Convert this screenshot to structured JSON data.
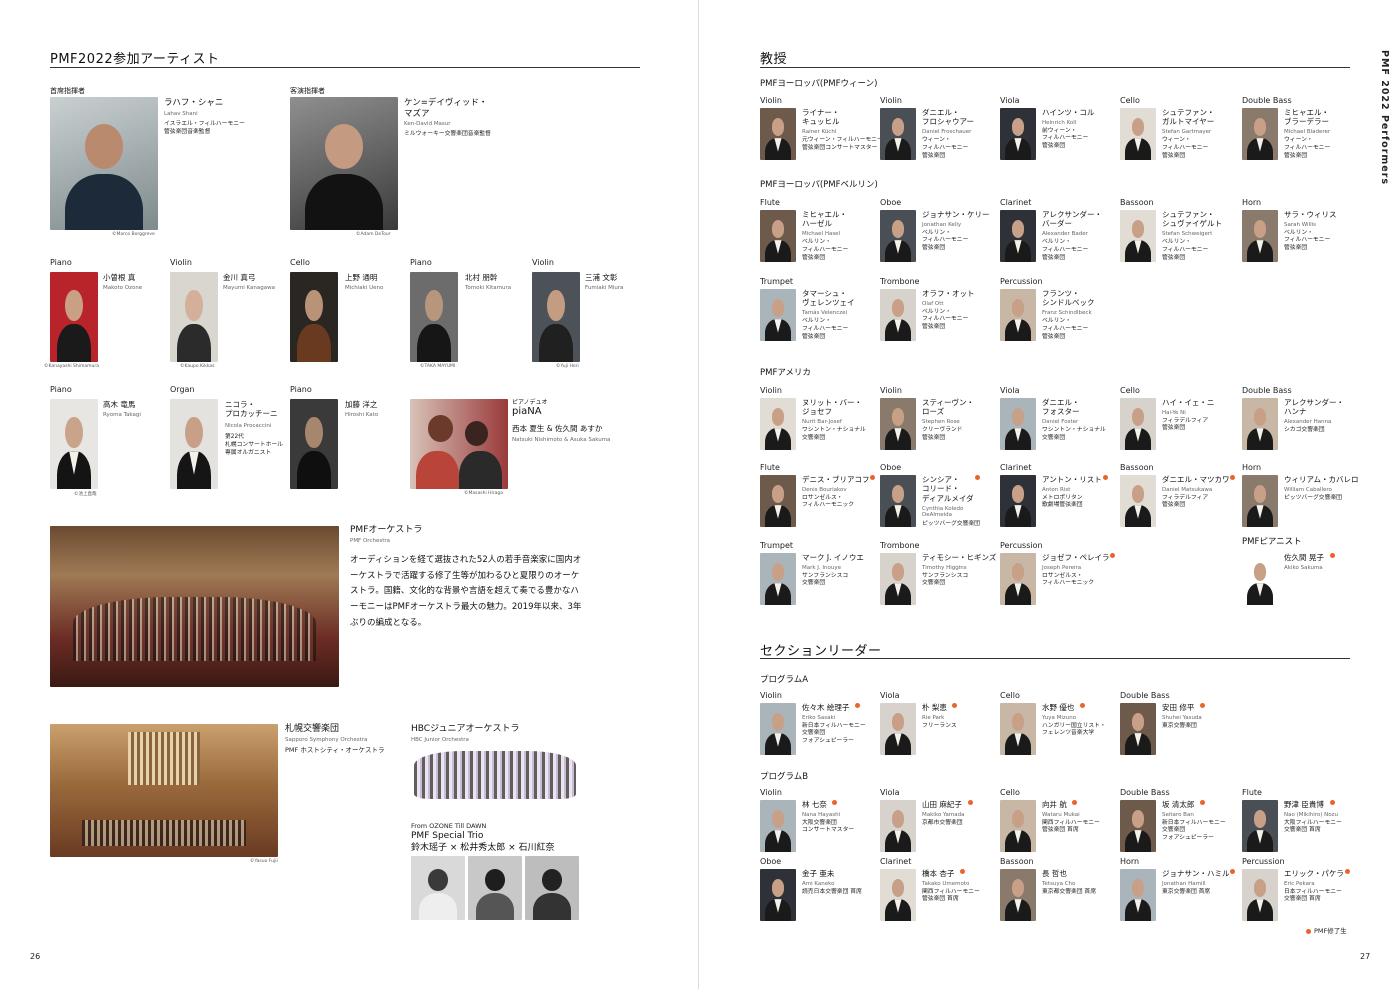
{
  "left": {
    "title": "PMF2022参加アーティスト",
    "conductors": [
      {
        "role": "首席指揮者",
        "name": "ラハフ・シャニ",
        "roman": "Lahav Shani",
        "org": "イスラエル・フィルハーモニー\n管弦楽団音楽監督",
        "credit": "©Marco Borggreve"
      },
      {
        "role": "客演指揮者",
        "name": "ケン=デイヴィッド・\nマズア",
        "roman": "Ken-David Masur",
        "org": "ミルウォーキー交響楽団音楽監督",
        "credit": "©Adam DeTour"
      }
    ],
    "soloists_row1": [
      {
        "inst": "Piano",
        "name": "小曽根 真",
        "roman": "Makoto Ozone",
        "credit": "©Kanayashi Shimamura"
      },
      {
        "inst": "Violin",
        "name": "金川 真弓",
        "roman": "Mayumi Kanagawa",
        "credit": "©Kaupo Kikkas"
      },
      {
        "inst": "Cello",
        "name": "上野 通明",
        "roman": "Michiaki Ueno",
        "credit": ""
      },
      {
        "inst": "Piano",
        "name": "北村 朋幹",
        "roman": "Tomoki Kitamura",
        "credit": "©TAKA MAYUMI"
      },
      {
        "inst": "Violin",
        "name": "三浦 文彰",
        "roman": "Fumiaki Miura",
        "credit": "©Yuji Hori"
      }
    ],
    "soloists_row2": [
      {
        "inst": "Piano",
        "name": "高木 竜馬",
        "roman": "Ryoma Takagi",
        "org": "",
        "credit": "©池上直哉"
      },
      {
        "inst": "Organ",
        "name": "ニコラ・\nプロカッチーニ",
        "roman": "Nicola Procaccini",
        "org": "第22代\n札幌コンサートホール\n専属オルガニスト",
        "credit": ""
      },
      {
        "inst": "Piano",
        "name": "加藤 洋之",
        "roman": "Hiroshi Kato",
        "org": "",
        "credit": ""
      }
    ],
    "piana": {
      "inst": "ピアノデュオ",
      "name": "piaNA",
      "members": "西本 夏生 & 佐久間 あすか",
      "roman": "Natsuki Nishimoto & Asuka Sakuma",
      "credit": "©Masashi Hiraga"
    },
    "orchestra": {
      "name": "PMFオーケストラ",
      "roman": "PMF Orchestra",
      "desc": "オーディションを経て選抜された52人の若手音楽家に国内オーケストラで活躍する修了生等が加わるひと夏限りのオーケストラ。国籍、文化的な背景や言語を超えて奏でる豊かなハーモニーはPMFオーケストラ最大の魅力。2019年以来、3年ぶりの編成となる。"
    },
    "sapporo": {
      "name": "札幌交響楽団",
      "roman": "Sapporo Symphony Orchestra",
      "note": "PMF ホストシティ・オーケストラ",
      "credit": "©Yasuo Fujii"
    },
    "hbc": {
      "name": "HBCジュニアオーケストラ",
      "roman": "HBC Junior Orchestra"
    },
    "trio": {
      "from": "From OZONE Till DAWN",
      "name": "PMF Special Trio",
      "members": "鈴木瑶子 × 松井秀太郎 × 石川紅奈"
    },
    "page_num": "26"
  },
  "right": {
    "title": "教授",
    "vertical_title": "PMF 2022  Performers",
    "groups": [
      {
        "label": "PMFヨーロッパ(PMFウィーン)"
      },
      {
        "label": "PMFヨーロッパ(PMFベルリン)"
      },
      {
        "label": "PMFアメリカ"
      },
      {
        "label": "PMFピアニスト"
      }
    ],
    "vienna": [
      {
        "inst": "Violin",
        "name": "ライナー・\nキュッヒル",
        "roman": "Rainer Küchl",
        "org": "元ウィーン・フィルハーモニー\n管弦楽団コンサートマスター",
        "dot": false
      },
      {
        "inst": "Violin",
        "name": "ダニエル・\nフロシャウアー",
        "roman": "Daniel Froschauer",
        "org": "ウィーン・\nフィルハーモニー\n管弦楽団",
        "dot": false
      },
      {
        "inst": "Viola",
        "name": "ハインツ・コル",
        "roman": "Heinrich Koll",
        "org": "前ウィーン・\nフィルハーモニー\n管弦楽団",
        "dot": false
      },
      {
        "inst": "Cello",
        "name": "シュテファン・\nガルトマイヤー",
        "roman": "Stefan Gartmayer",
        "org": "ウィーン・\nフィルハーモニー\n管弦楽団",
        "dot": false
      },
      {
        "inst": "Double Bass",
        "name": "ミヒャエル・\nブラーデラー",
        "roman": "Michael Bladerer",
        "org": "ウィーン・\nフィルハーモニー\n管弦楽団",
        "dot": false
      }
    ],
    "berlin": [
      {
        "inst": "Flute",
        "name": "ミヒャエル・\nハーゼル",
        "roman": "Michael Hasel",
        "org": "ベルリン・\nフィルハーモニー\n管弦楽団",
        "dot": false
      },
      {
        "inst": "Oboe",
        "name": "ジョナサン・ケリー",
        "roman": "Jonathan Kelly",
        "org": "ベルリン・\nフィルハーモニー\n管弦楽団",
        "dot": false
      },
      {
        "inst": "Clarinet",
        "name": "アレクサンダー・\nバーダー",
        "roman": "Alexander Bader",
        "org": "ベルリン・\nフィルハーモニー\n管弦楽団",
        "dot": false
      },
      {
        "inst": "Bassoon",
        "name": "シュテファン・\nシュヴァイゲルト",
        "roman": "Stefan Schweigert",
        "org": "ベルリン・\nフィルハーモニー\n管弦楽団",
        "dot": false
      },
      {
        "inst": "Horn",
        "name": "サラ・ウィリス",
        "roman": "Sarah Willis",
        "org": "ベルリン・\nフィルハーモニー\n管弦楽団",
        "dot": false
      },
      {
        "inst": "Trumpet",
        "name": "タマーシュ・\nヴェレンツェイ",
        "roman": "Tamás Velenczei",
        "org": "ベルリン・\nフィルハーモニー\n管弦楽団",
        "dot": false
      },
      {
        "inst": "Trombone",
        "name": "オラフ・オット",
        "roman": "Olaf Ott",
        "org": "ベルリン・\nフィルハーモニー\n管弦楽団",
        "dot": false
      },
      {
        "inst": "Percussion",
        "name": "フランツ・\nシンドルベック",
        "roman": "Franz Schindlbeck",
        "org": "ベルリン・\nフィルハーモニー\n管弦楽団",
        "dot": false
      }
    ],
    "america": [
      {
        "inst": "Violin",
        "name": "ヌリット・バー・\nジョセフ",
        "roman": "Nurit Bar-Josef",
        "org": "ワシントン・ナショナル\n交響楽団",
        "dot": false
      },
      {
        "inst": "Violin",
        "name": "スティーヴン・\nローズ",
        "roman": "Stephen Rose",
        "org": "クリーヴランド\n管弦楽団",
        "dot": false
      },
      {
        "inst": "Viola",
        "name": "ダニエル・\nフォスター",
        "roman": "Daniel Foster",
        "org": "ワシントン・ナショナル\n交響楽団",
        "dot": false
      },
      {
        "inst": "Cello",
        "name": "ハイ・イェ・ニ",
        "roman": "Hai-Ye Ni",
        "org": "フィラデルフィア\n管弦楽団",
        "dot": false
      },
      {
        "inst": "Double Bass",
        "name": "アレクサンダー・\nハンナ",
        "roman": "Alexander Hanna",
        "org": "シカゴ交響楽団",
        "dot": false
      },
      {
        "inst": "Flute",
        "name": "デニス・ブリアコフ",
        "roman": "Denis Bouriakov",
        "org": "ロサンゼルス・\nフィルハーモニック",
        "dot": true
      },
      {
        "inst": "Oboe",
        "name": "シンシア・\nコリード・\nディアルメイダ",
        "roman": "Cynthia Koledo\nDeAlmeida",
        "org": "ピッツバーグ交響楽団",
        "dot": true
      },
      {
        "inst": "Clarinet",
        "name": "アントン・リスト",
        "roman": "Anton Rist",
        "org": "メトロポリタン\n歌劇場管弦楽団",
        "dot": true
      },
      {
        "inst": "Bassoon",
        "name": "ダニエル・マツカワ",
        "roman": "Daniel Matsukawa",
        "org": "フィラデルフィア\n管弦楽団",
        "dot": true
      },
      {
        "inst": "Horn",
        "name": "ウィリアム・カバレロ",
        "roman": "William Caballero",
        "org": "ピッツバーグ交響楽団",
        "dot": false
      },
      {
        "inst": "Trumpet",
        "name": "マーク J. イノウエ",
        "roman": "Mark J. Inouye",
        "org": "サンフランシスコ\n交響楽団",
        "dot": false
      },
      {
        "inst": "Trombone",
        "name": "ティモシー・ヒギンズ",
        "roman": "Timothy Higgins",
        "org": "サンフランシスコ\n交響楽団",
        "dot": false
      },
      {
        "inst": "Percussion",
        "name": "ジョゼフ・ペレイラ",
        "roman": "Joseph Pereira",
        "org": "ロサンゼルス・\nフィルハーモニック",
        "dot": true
      }
    ],
    "pianist": {
      "name": "佐久間 晃子",
      "roman": "Akiko Sakuma",
      "dot": true
    },
    "section_title": "セクションリーダー",
    "progA_label": "プログラムA",
    "progA": [
      {
        "inst": "Violin",
        "name": "佐々木 絵理子",
        "roman": "Eriko Sasaki",
        "org": "新日本フィルハーモニー\n交響楽団\nフォアシュピーラー",
        "dot": true
      },
      {
        "inst": "Viola",
        "name": "朴 梨恵",
        "roman": "Rie Park",
        "org": "フリーランス",
        "dot": true
      },
      {
        "inst": "Cello",
        "name": "水野 優也",
        "roman": "Yuya Mizuno",
        "org": "ハンガリー国立リスト・\nフェレンツ音楽大学",
        "dot": true
      },
      {
        "inst": "Double Bass",
        "name": "安田 修平",
        "roman": "Shuhei Yasuda",
        "org": "東京交響楽団",
        "dot": true
      }
    ],
    "progB_label": "プログラムB",
    "progB": [
      {
        "inst": "Violin",
        "name": "林 七奈",
        "roman": "Nana Hayashi",
        "org": "大阪交響楽団\nコンサートマスター",
        "dot": true
      },
      {
        "inst": "Viola",
        "name": "山田 麻紀子",
        "roman": "Makiko Yamada",
        "org": "京都市交響楽団",
        "dot": true
      },
      {
        "inst": "Cello",
        "name": "向井 航",
        "roman": "Wataru Mukai",
        "org": "関西フィルハーモニー\n管弦楽団 首席",
        "dot": true
      },
      {
        "inst": "Double Bass",
        "name": "坂 清太郎",
        "roman": "Seitaro Ban",
        "org": "新日本フィルハーモニー\n交響楽団\nフォアシュピーラー",
        "dot": true
      },
      {
        "inst": "Flute",
        "name": "野津 臣貴博",
        "roman": "Nao (Mikihiro) Nozu",
        "org": "大阪フィルハーモニー\n交響楽団 首席",
        "dot": true
      },
      {
        "inst": "Oboe",
        "name": "金子 亜未",
        "roman": "Ami Kaneko",
        "org": "読売日本交響楽団 首席",
        "dot": false
      },
      {
        "inst": "Clarinet",
        "name": "橋本 杏子",
        "roman": "Takako Umemoto",
        "org": "関西フィルハーモニー\n管弦楽団 首席",
        "dot": true
      },
      {
        "inst": "Bassoon",
        "name": "長 哲也",
        "roman": "Tetsuya Cho",
        "org": "東京都交響楽団 首席",
        "dot": false
      },
      {
        "inst": "Horn",
        "name": "ジョナサン・ハミル",
        "roman": "Jonathan Hamill",
        "org": "東京交響楽団 首席",
        "dot": true
      },
      {
        "inst": "Percussion",
        "name": "エリック・パケラ",
        "roman": "Eric Pekara",
        "org": "日本フィルハーモニー\n交響楽団 首席",
        "dot": true
      }
    ],
    "legend": "PMF修了生",
    "page_num": "27"
  },
  "colors": {
    "accent": "#e8642c",
    "rule": "#333333"
  }
}
